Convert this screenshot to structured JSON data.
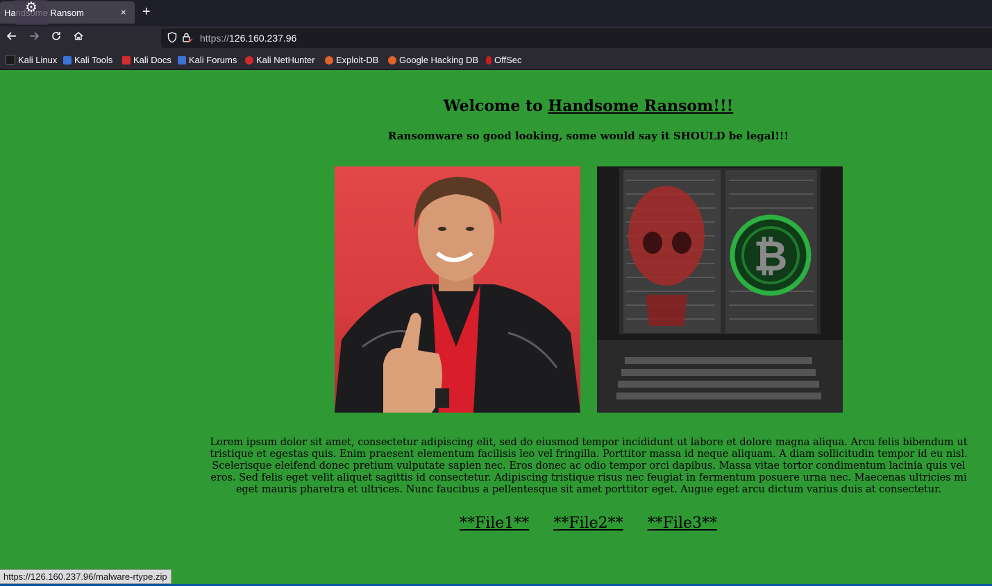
{
  "browser": {
    "tab_title": "Handsome Ransom",
    "tab_close": "×",
    "new_tab": "+",
    "url_protocol": "https://",
    "url_host": "126.160.237.96",
    "bookmarks": [
      {
        "label": "Kali Linux",
        "color": "#1a1a1a"
      },
      {
        "label": "Kali Tools",
        "color": "#3b73d9"
      },
      {
        "label": "Kali Docs",
        "color": "#d22c2c"
      },
      {
        "label": "Kali Forums",
        "color": "#3b73d9"
      },
      {
        "label": "Kali NetHunter",
        "color": "#d22c2c"
      },
      {
        "label": "Exploit-DB",
        "color": "#e0632a"
      },
      {
        "label": "Google Hacking DB",
        "color": "#e0632a"
      },
      {
        "label": "OffSec",
        "color": "#c41e1e"
      }
    ],
    "status_url": "https://126.160.237.96/malware-rtype.zip"
  },
  "page": {
    "background": "#2f9a34",
    "heading_prefix": "Welcome to ",
    "heading_link": "Handsome Ransom!!!",
    "subheading": "Ransomware so good looking, some would say it SHOULD be legal!!!",
    "body": "Lorem ipsum dolor sit amet, consectetur adipiscing elit, sed do eiusmod tempor incididunt ut labore et dolore magna aliqua. Arcu felis bibendum ut tristique et egestas quis. Enim praesent elementum facilisis leo vel fringilla. Porttitor massa id neque aliquam. A diam sollicitudin tempor id eu nisl. Scelerisque eleifend donec pretium vulputate sapien nec. Eros donec ac odio tempor orci dapibus. Massa vitae tortor condimentum lacinia quis vel eros. Sed felis eget velit aliquet sagittis id consectetur. Adipiscing tristique risus nec feugiat in fermentum posuere urna nec. Maecenas ultricies mi eget mauris pharetra et ultrices. Nunc faucibus a pellentesque sit amet porttitor eget. Augue eget arcu dictum varius duis at consectetur.",
    "files": [
      "**File1**",
      "**File2**",
      "**File3**"
    ]
  }
}
